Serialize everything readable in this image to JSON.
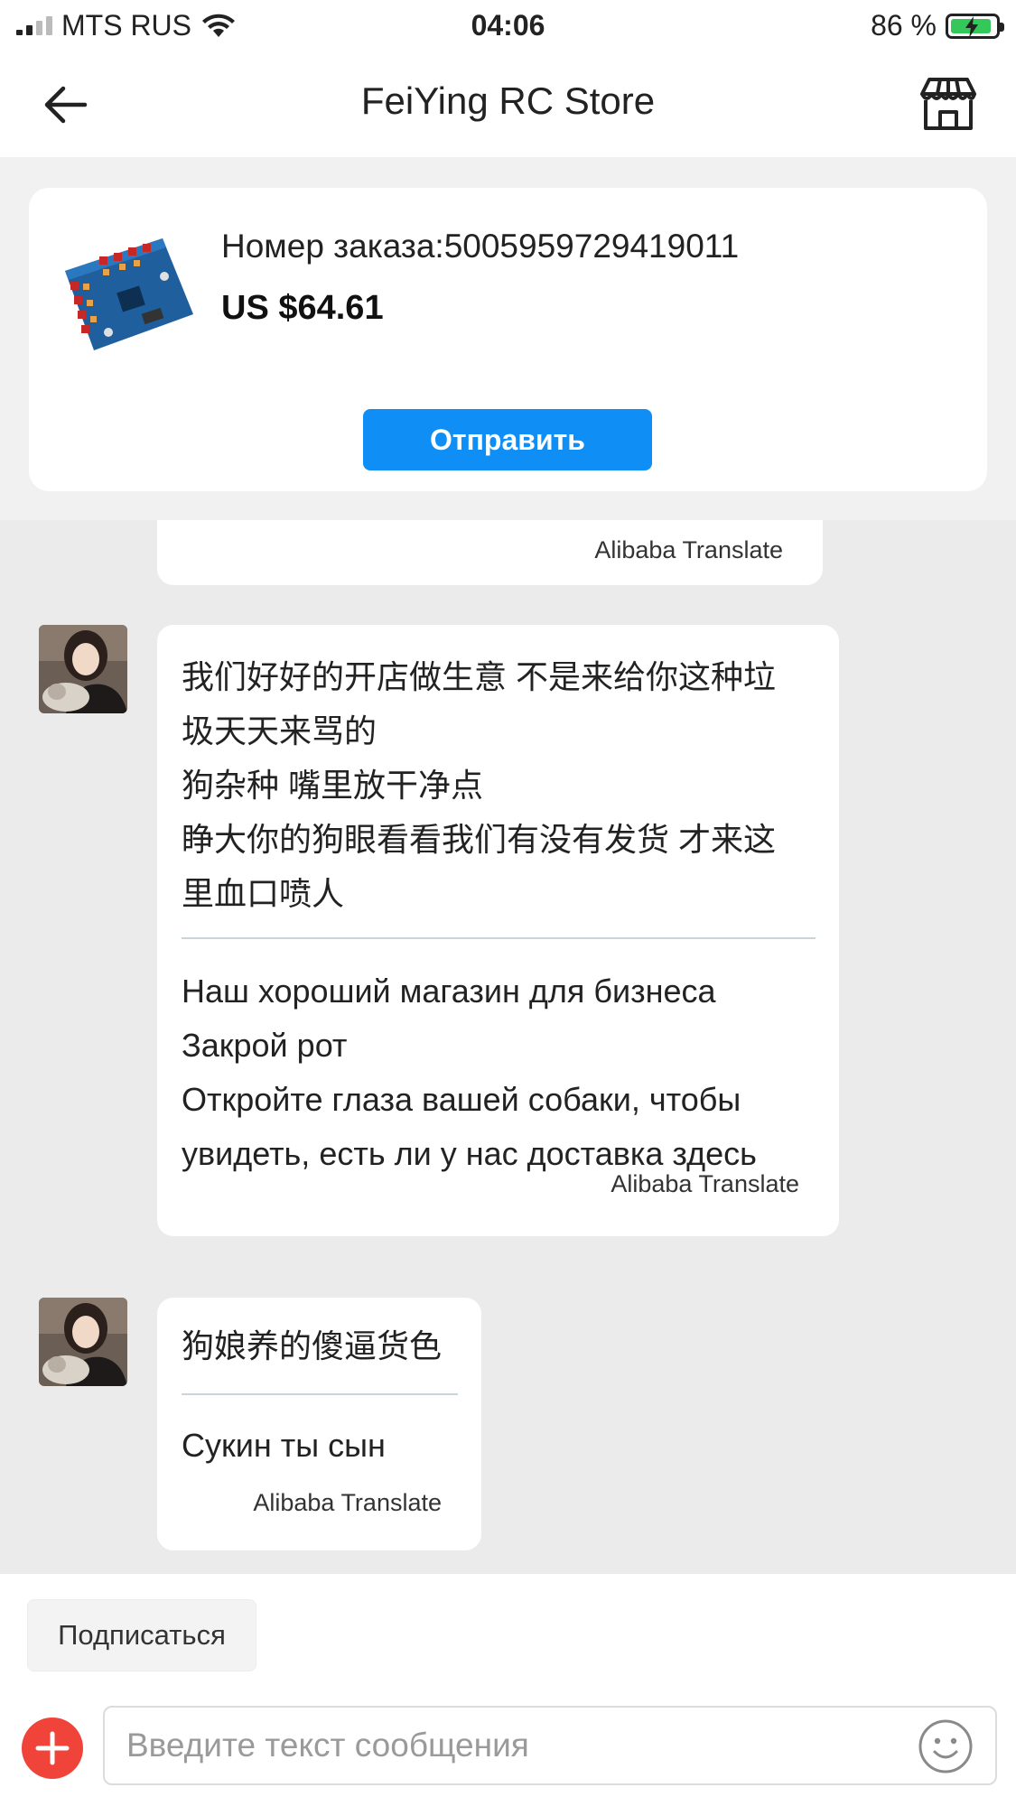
{
  "status_bar": {
    "carrier": "MTS RUS",
    "time": "04:06",
    "battery_percent": "86 %",
    "battery_level": 0.86,
    "signal_bars": 4,
    "signal_bars_active": 2
  },
  "nav": {
    "title": "FeiYing RC Store",
    "back_icon": "arrow-left-icon",
    "store_icon": "storefront-icon"
  },
  "order": {
    "number_text": "Номер заказа:5005959729419011",
    "price": "US $64.61",
    "send_label": "Отправить"
  },
  "messages": [
    {
      "original_lines": [],
      "translation_lines": [],
      "tag": "Alibaba Translate"
    },
    {
      "original_lines": [
        "我们好好的开店做生意 不是来给你这种垃",
        "圾天天来骂的",
        "狗杂种 嘴里放干净点",
        "睁大你的狗眼看看我们有没有发货 才来这",
        "里血口喷人"
      ],
      "translation_lines": [
        "Наш хороший магазин для бизнеса",
        "Закрой рот",
        "Откройте глаза вашей собаки, чтобы",
        "увидеть, есть ли у нас доставка здесь"
      ],
      "tag": "Alibaba Translate"
    },
    {
      "original_lines": [
        "狗娘养的傻逼货色"
      ],
      "translation_lines": [
        "Сукин ты сын"
      ],
      "tag": "Alibaba Translate"
    }
  ],
  "bottom": {
    "subscribe_label": "Подписаться",
    "input_placeholder": "Введите текст сообщения"
  },
  "colors": {
    "accent": "#0f8ff5",
    "add_button": "#f0443a",
    "battery": "#34c759"
  }
}
